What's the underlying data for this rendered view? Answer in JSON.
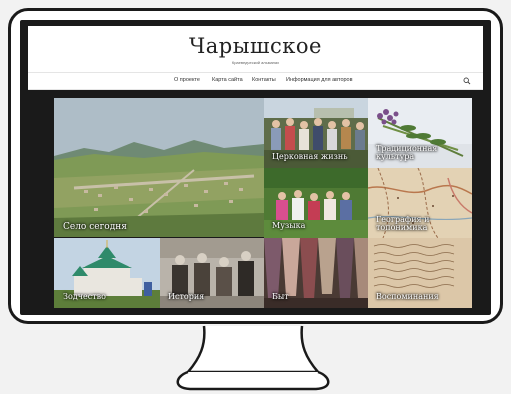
{
  "site": {
    "title": "Чарышское",
    "subtitle": "Краеведческий альманах"
  },
  "nav": {
    "items": [
      "О проекте",
      "Карта сайта",
      "Контакты",
      "Информация для авторов"
    ],
    "search_icon": "search-icon"
  },
  "tiles": [
    {
      "label": "Село сегодня"
    },
    {
      "label": "Церковная жизнь"
    },
    {
      "label": "Традиционная культура"
    },
    {
      "label": "Музыка"
    },
    {
      "label": "География и топонимика"
    },
    {
      "label": "Зодчество"
    },
    {
      "label": "История"
    },
    {
      "label": "Быт"
    },
    {
      "label": "Воспоминания"
    }
  ],
  "colors": {
    "frame": "#1a1a1a",
    "screen_bg": "#ffffff",
    "content_bg": "#1a1a1a"
  }
}
